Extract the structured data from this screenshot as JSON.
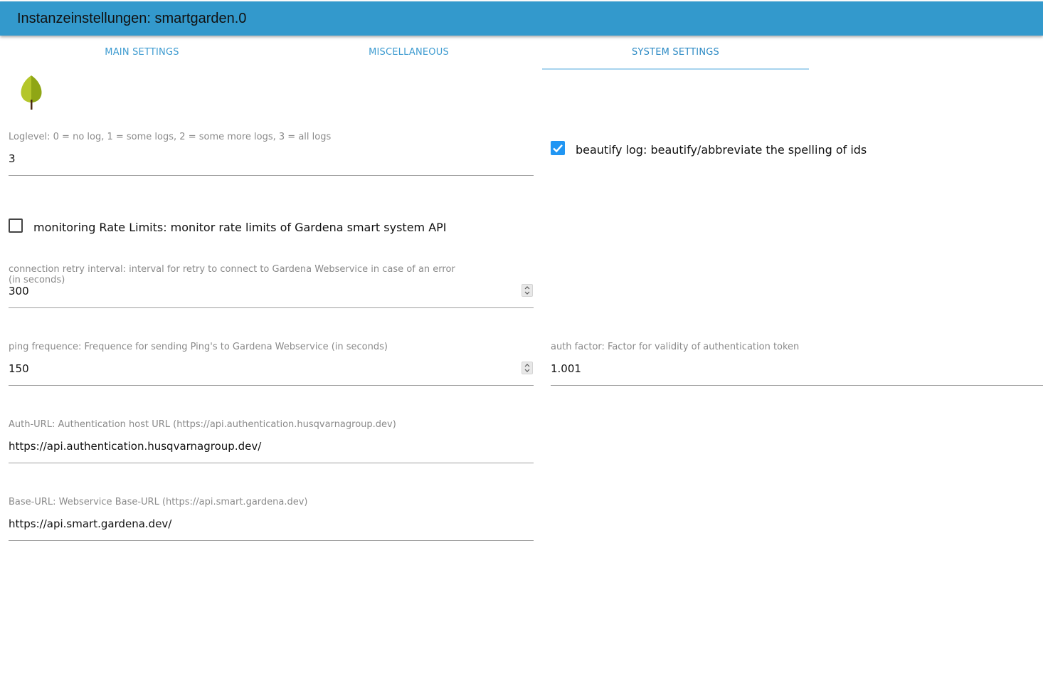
{
  "header": {
    "title": "Instanzeinstellungen: smartgarden.0"
  },
  "tabs": [
    {
      "label": "MAIN SETTINGS",
      "active": false
    },
    {
      "label": "MISCELLANEOUS",
      "active": false
    },
    {
      "label": "SYSTEM SETTINGS",
      "active": true
    }
  ],
  "logo": {
    "icon": "leaf-icon"
  },
  "fields": {
    "loglevel": {
      "label": "Loglevel: 0 = no log, 1 = some logs, 2 = some more logs, 3 = all logs",
      "value": "3"
    },
    "beautify_log": {
      "label": "beautify log: beautify/abbreviate the spelling of ids",
      "checked": true
    },
    "monitoring_rate_limits": {
      "label": "monitoring Rate Limits: monitor rate limits of Gardena smart system API",
      "checked": false
    },
    "connection_retry": {
      "label_line1": "connection retry interval: interval for retry to connect to Gardena Webservice in case of an error",
      "label_line2": "(in seconds)",
      "value": "300"
    },
    "ping_frequence": {
      "label": "ping frequence: Frequence for sending Ping's to Gardena Webservice (in seconds)",
      "value": "150"
    },
    "auth_factor": {
      "label": "auth factor: Factor for validity of authentication token",
      "value": "1.001"
    },
    "auth_url": {
      "label": "Auth-URL: Authentication host URL (https://api.authentication.husqvarnagroup.dev)",
      "value": "https://api.authentication.husqvarnagroup.dev/"
    },
    "base_url": {
      "label": "Base-URL: Webservice Base-URL (https://api.smart.gardena.dev)",
      "value": "https://api.smart.gardena.dev/"
    }
  },
  "colors": {
    "header_bg": "#3399cc",
    "tab_text": "#3d9bd0",
    "checkbox_checked": "#2196f3"
  }
}
